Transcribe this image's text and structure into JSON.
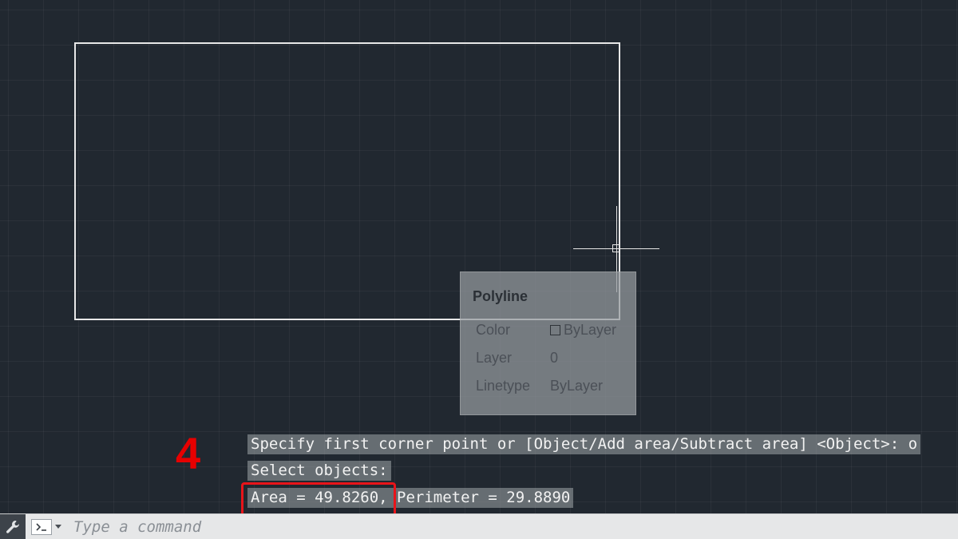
{
  "drawing": {
    "tooltip": {
      "title": "Polyline",
      "rows": [
        {
          "label": "Color",
          "value": "ByLayer"
        },
        {
          "label": "Layer",
          "value": "0"
        },
        {
          "label": "Linetype",
          "value": "ByLayer"
        }
      ]
    }
  },
  "command_history": {
    "line1": "Specify first corner point or [Object/Add area/Subtract area] <Object>: o",
    "line2": "Select objects:",
    "line3": "Area = 49.8260, Perimeter = 29.8890"
  },
  "annotation": {
    "step_number": "4",
    "highlight_color": "#e8141a"
  },
  "command_bar": {
    "placeholder": "Type a command",
    "icons": [
      "wrench-icon",
      "command-prompt-icon",
      "chevron-down-icon"
    ]
  },
  "colors": {
    "background": "#212830",
    "tooltip_bg": "#969ba0"
  }
}
